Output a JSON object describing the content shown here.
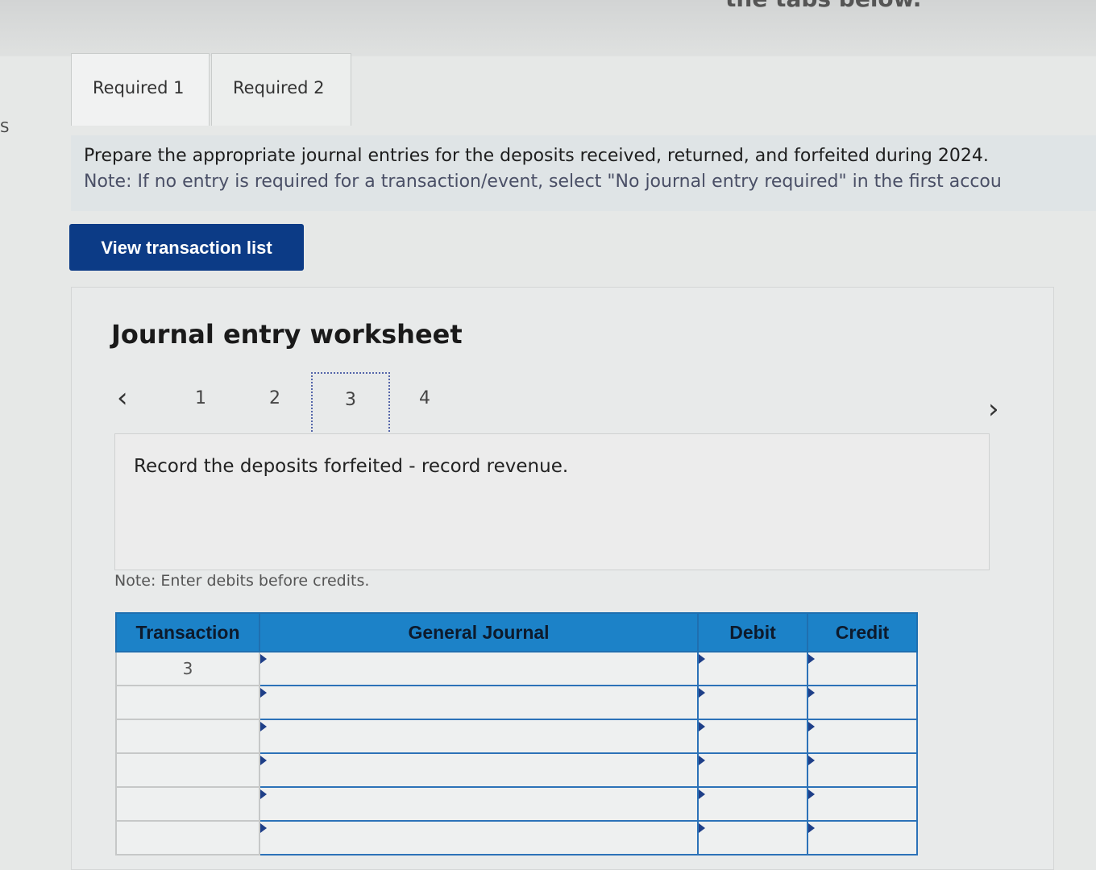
{
  "header": {
    "partial_text": "the tabs below."
  },
  "edge_mark": "S",
  "tabs": [
    {
      "label": "Required 1",
      "active": true
    },
    {
      "label": "Required 2",
      "active": false
    }
  ],
  "instructions": {
    "prompt": "Prepare the appropriate journal entries for the deposits received, returned, and forfeited during 2024.",
    "note": "Note: If no entry is required for a transaction/event, select \"No journal entry required\" in the first accou"
  },
  "view_transaction_button": "View transaction list",
  "worksheet": {
    "title": "Journal entry worksheet",
    "nav": {
      "prev": "‹",
      "next": "›"
    },
    "pages": [
      "1",
      "2",
      "3",
      "4"
    ],
    "current_page": "3",
    "description": "Record the deposits forfeited - record revenue.",
    "entry_note": "Note: Enter debits before credits."
  },
  "journal_table": {
    "headers": {
      "transaction": "Transaction",
      "general_journal": "General Journal",
      "debit": "Debit",
      "credit": "Credit"
    },
    "rows": [
      {
        "transaction": "3",
        "account": "",
        "debit": "",
        "credit": ""
      },
      {
        "transaction": "",
        "account": "",
        "debit": "",
        "credit": ""
      },
      {
        "transaction": "",
        "account": "",
        "debit": "",
        "credit": ""
      },
      {
        "transaction": "",
        "account": "",
        "debit": "",
        "credit": ""
      },
      {
        "transaction": "",
        "account": "",
        "debit": "",
        "credit": ""
      },
      {
        "transaction": "",
        "account": "",
        "debit": "",
        "credit": ""
      }
    ]
  },
  "colors": {
    "primary_button": "#0c3b86",
    "table_header": "#1c82c8",
    "grid_border": "#2c72b8"
  }
}
